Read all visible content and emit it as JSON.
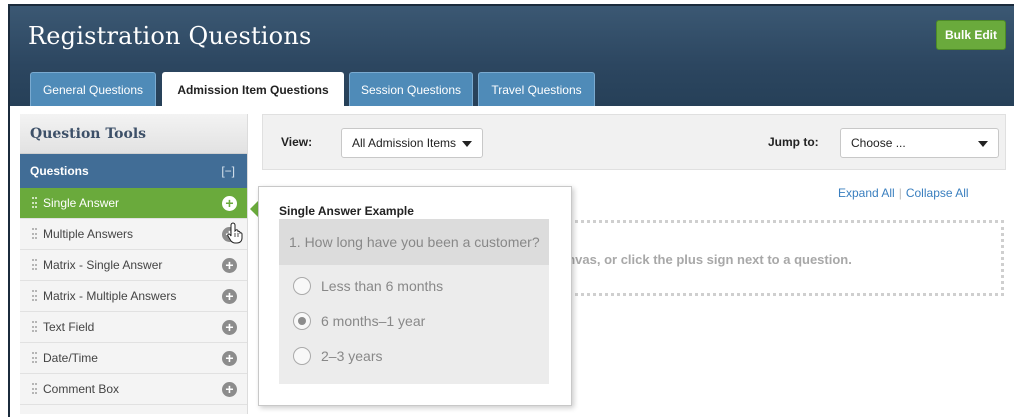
{
  "header": {
    "title": "Registration Questions",
    "bulk_edit_label": "Bulk Edit"
  },
  "tabs": [
    {
      "label": "General Questions",
      "active": false
    },
    {
      "label": "Admission Item Questions",
      "active": true
    },
    {
      "label": "Session Questions",
      "active": false
    },
    {
      "label": "Travel Questions",
      "active": false
    }
  ],
  "sidebar": {
    "title": "Question Tools",
    "section_label": "Questions",
    "collapse_label": "[−]",
    "items": [
      {
        "label": "Single Answer",
        "selected": true
      },
      {
        "label": "Multiple Answers"
      },
      {
        "label": "Matrix - Single Answer"
      },
      {
        "label": "Matrix - Multiple Answers"
      },
      {
        "label": "Text Field"
      },
      {
        "label": "Date/Time"
      },
      {
        "label": "Comment Box"
      }
    ],
    "add_icon": "plus-circle-icon"
  },
  "toolbar": {
    "view_label": "View:",
    "view_value": "All Admission Items",
    "jump_label": "Jump to:",
    "jump_value": "Choose ..."
  },
  "links": {
    "expand_all": "Expand All",
    "collapse_all": "Collapse All"
  },
  "canvas": {
    "hint_text": "anvas, or click the plus sign next to a question."
  },
  "popover": {
    "title": "Single Answer Example",
    "question": "1. How long have you been a customer?",
    "options": [
      {
        "label": "Less than 6 months",
        "checked": false
      },
      {
        "label": "6 months–1 year",
        "checked": true
      },
      {
        "label": "2–3 years",
        "checked": false
      }
    ]
  },
  "colors": {
    "header_bg": "#2c4660",
    "tab_blue": "#4f8bb8",
    "accent_green": "#6aaa3c",
    "link_blue": "#3a7fbf"
  }
}
